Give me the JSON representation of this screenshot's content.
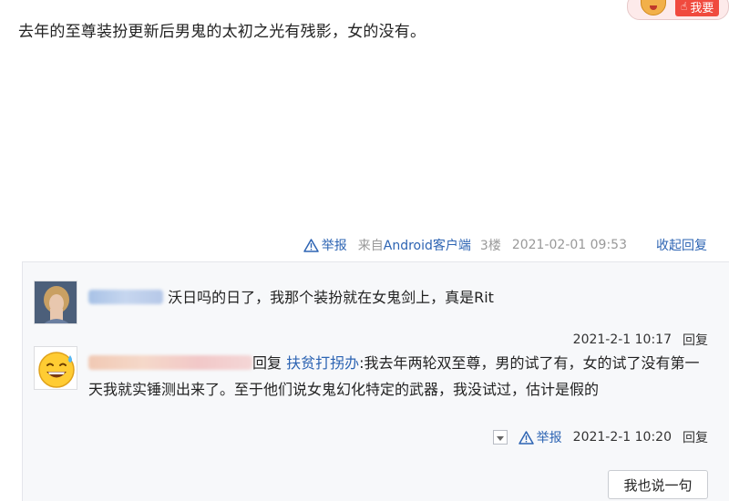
{
  "post": {
    "text": "去年的至尊装扮更新后男鬼的太初之光有残影，女的没有。",
    "report_label": "举报",
    "client_prefix": "来自",
    "client_name": "Android客户端",
    "floor": "3楼",
    "datetime": "2021-02-01 09:53",
    "collapse_label": "收起回复"
  },
  "corner_badge": {
    "label": "我要"
  },
  "replies": [
    {
      "text": "沃日吗的日了，我那个装扮就在女鬼剑上，真是Rit",
      "datetime": "2021-2-1 10:17",
      "reply_label": "回复"
    },
    {
      "reply_word": "回复",
      "target": "扶贫打拐办",
      "text": ":我去年两轮双至尊，男的试了有，女的试了没有第一天我就实锤测出来了。至于他们说女鬼幻化特定的武器，我没试过，估计是假的",
      "report_label": "举报",
      "datetime": "2021-2-1 10:20",
      "reply_label": "回复"
    }
  ],
  "say_button": "我也说一句",
  "colors": {
    "link": "#2d64b3",
    "meta": "#999999",
    "reply_bg": "#f7f8fa",
    "badge_red": "#f04a3e"
  }
}
